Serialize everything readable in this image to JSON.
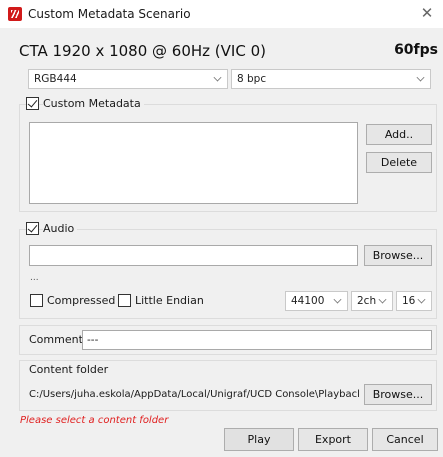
{
  "window": {
    "title": "Custom Metadata Scenario",
    "close_glyph": "✕"
  },
  "mode": {
    "title": "CTA 1920 x 1080 @ 60Hz (VIC 0)",
    "fps": "60fps"
  },
  "color_format": {
    "selected": "RGB444"
  },
  "bit_depth": {
    "selected": "8 bpc"
  },
  "metadata": {
    "checkbox_label": "Custom Metadata",
    "checked": true,
    "add_label": "Add..",
    "delete_label": "Delete"
  },
  "audio": {
    "checkbox_label": "Audio",
    "checked": true,
    "file_value": "",
    "browse_label": "Browse...",
    "info_text": "...",
    "compressed_label": "Compressed",
    "little_endian_label": "Little Endian",
    "sample_rate": "44100",
    "channels": "2ch",
    "bits": "16"
  },
  "comment": {
    "label": "Comment",
    "value": "---"
  },
  "content_folder": {
    "label": "Content folder",
    "path": "C:/Users/juha.eskola/AppData/Local/Unigraf/UCD Console\\Playback",
    "browse_label": "Browse...",
    "error_text": "Please select a content folder"
  },
  "buttons": {
    "play": "Play",
    "export": "Export",
    "cancel": "Cancel"
  },
  "icons": {
    "app": "unigraf-logo-icon",
    "close": "close-icon"
  },
  "colors": {
    "error": "#e02020",
    "logo": "#d11a1a"
  }
}
